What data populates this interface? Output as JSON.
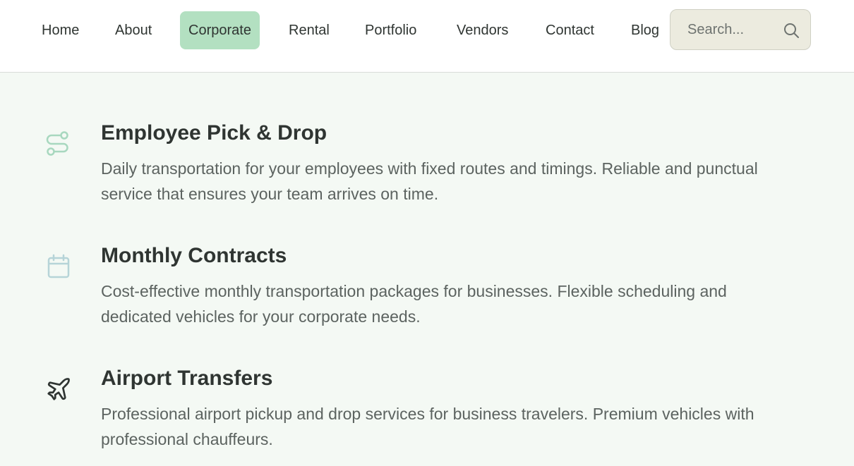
{
  "nav": {
    "items": [
      {
        "label": "Home"
      },
      {
        "label": "About"
      },
      {
        "label": "Corporate",
        "active": true
      },
      {
        "label": "Rental"
      },
      {
        "label": "Portfolio"
      },
      {
        "label": "Vendors"
      },
      {
        "label": "Contact"
      },
      {
        "label": "Blog"
      }
    ],
    "active_color": "#b3e0c1"
  },
  "search": {
    "placeholder": "Search...",
    "value": "",
    "icon": "search-icon"
  },
  "services": [
    {
      "icon": "route-icon",
      "title": "Employee Pick & Drop",
      "description": "Daily transportation for your employees with fixed routes and timings. Reliable and punctual service that ensures your team arrives on time."
    },
    {
      "icon": "calendar-icon",
      "title": "Monthly Contracts",
      "description": "Cost-effective monthly transportation packages for businesses. Flexible scheduling and dedicated vehicles for your corporate needs."
    },
    {
      "icon": "plane-icon",
      "title": "Airport Transfers",
      "description": "Professional airport pickup and drop services for business travelers. Premium vehicles with professional chauffeurs."
    }
  ],
  "colors": {
    "background": "#f4f9f4",
    "text_dark": "#2f3532",
    "text_muted": "#5c6360",
    "icon_green": "#a8d8bf",
    "icon_blue": "#b6d4d8"
  }
}
